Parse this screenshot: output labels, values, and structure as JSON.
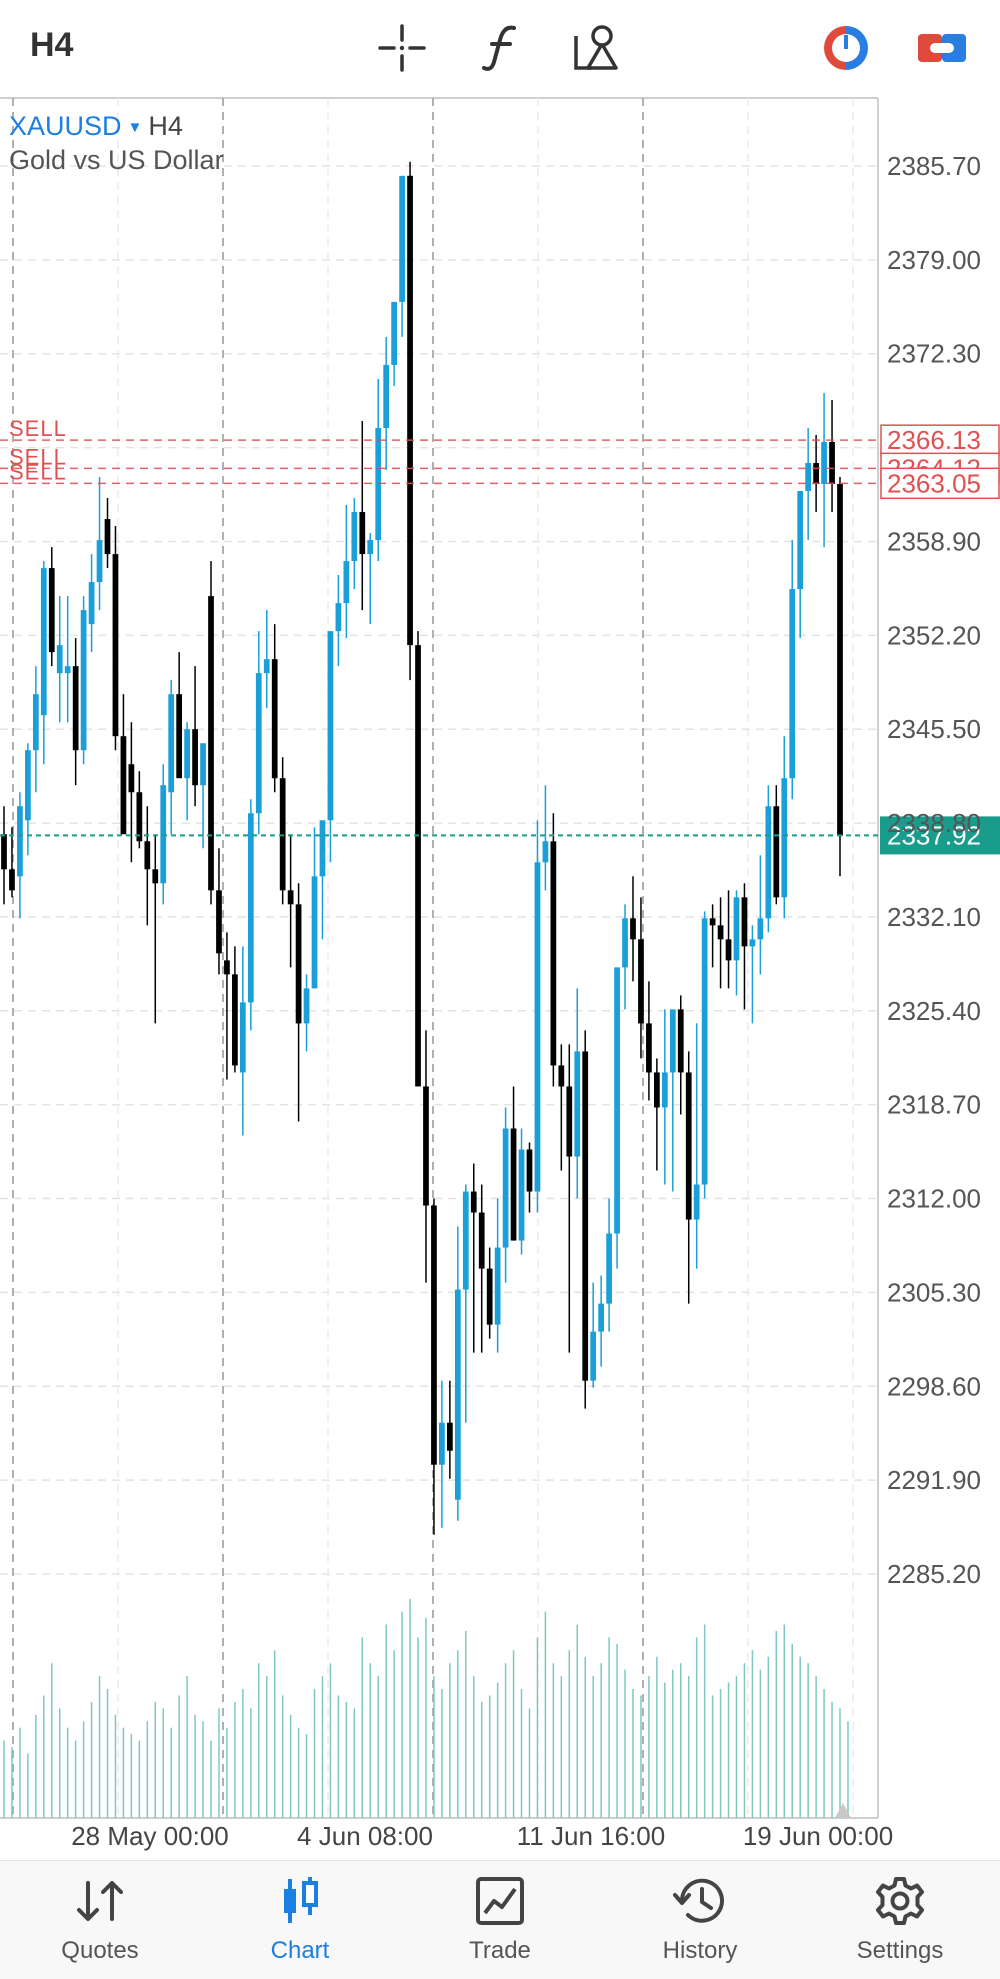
{
  "toolbar": {
    "timeframe": "H4",
    "icons": [
      "crosshair-icon",
      "indicators-icon",
      "objects-icon",
      "one-click-trading-icon",
      "toggle-icon"
    ]
  },
  "chart_header": {
    "symbol": "XAUUSD",
    "timeframe": "H4",
    "description": "Gold vs US Dollar"
  },
  "colors": {
    "bull": "#1a9fd9",
    "bear": "#000000",
    "volume": "#7fc8c2",
    "sell_line": "#e05050",
    "bid_line": "#1a9c8c",
    "grid": "#e3e3e3",
    "accent": "#1a7fe0"
  },
  "chart_data": {
    "type": "candlestick",
    "symbol": "XAUUSD",
    "timeframe": "H4",
    "y_ticks": [
      2385.7,
      2379.0,
      2372.3,
      2365.6,
      2358.9,
      2352.2,
      2345.5,
      2338.8,
      2332.1,
      2325.4,
      2318.7,
      2312.0,
      2305.3,
      2298.6,
      2291.9,
      2285.2
    ],
    "y_tick_labels": [
      "2385.70",
      "2379.00",
      "2372.30",
      "",
      "2358.90",
      "2352.20",
      "2345.50",
      "2338.80",
      "2332.10",
      "2325.40",
      "2318.70",
      "2312.00",
      "2305.30",
      "2298.60",
      "2291.90",
      "2285.20"
    ],
    "ylim": [
      2275.4,
      2386.2
    ],
    "x_labels": [
      "28 May 00:00",
      "4 Jun 08:00",
      "11 Jun 16:00",
      "19 Jun 00:00"
    ],
    "current_price": 2337.92,
    "current_price_label": "2337.92",
    "order_lines": [
      {
        "label": "SELL",
        "price": 2366.13,
        "price_label": "2366.13"
      },
      {
        "label": "SELL",
        "price": 2364.12,
        "price_label": "2364.12"
      },
      {
        "label": "SELL",
        "price": 2363.05,
        "price_label": "2363.05"
      }
    ],
    "candles": [
      [
        2338.0,
        2340.0,
        2333.0,
        2335.5
      ],
      [
        2335.5,
        2338.5,
        2333.5,
        2334.0
      ],
      [
        2335.0,
        2341.0,
        2332.0,
        2340.0
      ],
      [
        2339.0,
        2344.5,
        2336.5,
        2344.0
      ],
      [
        2344.0,
        2350.0,
        2341.0,
        2348.0
      ],
      [
        2346.5,
        2357.5,
        2343.0,
        2357.0
      ],
      [
        2357.0,
        2358.5,
        2350.0,
        2351.0
      ],
      [
        2349.5,
        2355.0,
        2346.0,
        2351.5
      ],
      [
        2349.5,
        2355.0,
        2346.0,
        2350.0
      ],
      [
        2350.0,
        2352.0,
        2341.5,
        2344.0
      ],
      [
        2344.0,
        2355.0,
        2343.0,
        2354.0
      ],
      [
        2353.0,
        2358.0,
        2351.0,
        2356.0
      ],
      [
        2356.0,
        2363.5,
        2354.0,
        2359.0
      ],
      [
        2360.5,
        2362.0,
        2357.0,
        2358.0
      ],
      [
        2358.0,
        2360.0,
        2344.0,
        2345.0
      ],
      [
        2345.0,
        2348.0,
        2339.0,
        2338.0
      ],
      [
        2343.0,
        2346.0,
        2336.0,
        2341.0
      ],
      [
        2341.0,
        2342.5,
        2337.0,
        2337.5
      ],
      [
        2337.5,
        2340.0,
        2331.5,
        2335.5
      ],
      [
        2335.5,
        2338.0,
        2324.5,
        2334.5
      ],
      [
        2334.5,
        2343.0,
        2333.0,
        2341.5
      ],
      [
        2341.0,
        2349.0,
        2338.0,
        2348.0
      ],
      [
        2348.0,
        2351.0,
        2342.5,
        2342.0
      ],
      [
        2342.0,
        2346.0,
        2339.0,
        2345.5
      ],
      [
        2345.5,
        2350.0,
        2340.0,
        2341.5
      ],
      [
        2341.5,
        2344.0,
        2337.0,
        2344.5
      ],
      [
        2355.0,
        2357.5,
        2333.0,
        2334.0
      ],
      [
        2334.0,
        2337.0,
        2328.0,
        2329.5
      ],
      [
        2329.0,
        2331.0,
        2320.5,
        2328.0
      ],
      [
        2328.0,
        2330.0,
        2321.0,
        2321.5
      ],
      [
        2321.0,
        2330.0,
        2316.5,
        2326.0
      ],
      [
        2326.0,
        2340.5,
        2324.0,
        2339.5
      ],
      [
        2339.5,
        2352.5,
        2338.0,
        2349.5
      ],
      [
        2349.5,
        2354.0,
        2347.0,
        2350.5
      ],
      [
        2350.5,
        2353.0,
        2341.0,
        2342.0
      ],
      [
        2342.0,
        2343.5,
        2333.0,
        2334.0
      ],
      [
        2334.0,
        2338.0,
        2328.5,
        2333.0
      ],
      [
        2333.0,
        2334.5,
        2317.5,
        2324.5
      ],
      [
        2324.5,
        2328.0,
        2322.5,
        2327.0
      ],
      [
        2327.0,
        2338.5,
        2327.0,
        2335.0
      ],
      [
        2335.0,
        2338.0,
        2330.5,
        2339.0
      ],
      [
        2339.0,
        2348.0,
        2336.0,
        2352.5
      ],
      [
        2352.5,
        2356.5,
        2350.0,
        2354.5
      ],
      [
        2354.5,
        2361.5,
        2352.0,
        2357.5
      ],
      [
        2357.5,
        2362.0,
        2355.5,
        2361.0
      ],
      [
        2361.0,
        2367.5,
        2354.0,
        2358.0
      ],
      [
        2358.0,
        2359.5,
        2353.0,
        2359.0
      ],
      [
        2359.0,
        2370.5,
        2357.5,
        2367.0
      ],
      [
        2367.0,
        2373.5,
        2364.0,
        2371.5
      ],
      [
        2371.5,
        2375.5,
        2370.0,
        2376.0
      ],
      [
        2376.0,
        2383.0,
        2373.5,
        2385.0
      ],
      [
        2385.0,
        2386.0,
        2349.0,
        2351.5
      ],
      [
        2351.5,
        2352.5,
        2325.0,
        2320.0
      ],
      [
        2320.0,
        2324.0,
        2306.0,
        2311.5
      ],
      [
        2311.5,
        2312.0,
        2288.0,
        2293.0
      ],
      [
        2293.0,
        2299.0,
        2288.5,
        2296.0
      ],
      [
        2296.0,
        2299.0,
        2292.0,
        2294.0
      ],
      [
        2290.5,
        2310.0,
        2289.0,
        2305.5
      ],
      [
        2305.5,
        2313.0,
        2296.0,
        2312.5
      ],
      [
        2312.5,
        2314.5,
        2301.0,
        2311.0
      ],
      [
        2311.0,
        2313.0,
        2301.0,
        2307.0
      ],
      [
        2307.0,
        2308.5,
        2302.0,
        2303.0
      ],
      [
        2303.0,
        2312.0,
        2301.0,
        2308.5
      ],
      [
        2308.5,
        2318.5,
        2306.0,
        2317.0
      ],
      [
        2317.0,
        2320.0,
        2309.0,
        2309.0
      ],
      [
        2309.0,
        2317.0,
        2308.0,
        2315.5
      ],
      [
        2315.5,
        2316.0,
        2311.0,
        2312.5
      ],
      [
        2312.5,
        2339.0,
        2311.0,
        2336.0
      ],
      [
        2336.0,
        2341.5,
        2334.0,
        2337.5
      ],
      [
        2337.5,
        2339.5,
        2320.0,
        2321.5
      ],
      [
        2321.5,
        2323.0,
        2314.0,
        2320.0
      ],
      [
        2320.0,
        2323.0,
        2301.0,
        2315.0
      ],
      [
        2315.0,
        2327.0,
        2312.0,
        2322.5
      ],
      [
        2322.5,
        2324.0,
        2297.0,
        2299.0
      ],
      [
        2299.0,
        2306.0,
        2298.5,
        2302.5
      ],
      [
        2302.5,
        2306.5,
        2300.0,
        2304.5
      ],
      [
        2304.5,
        2312.0,
        2302.5,
        2309.5
      ],
      [
        2309.5,
        2321.5,
        2307.0,
        2328.5
      ],
      [
        2328.5,
        2333.0,
        2325.5,
        2332.0
      ],
      [
        2332.0,
        2335.0,
        2327.5,
        2330.5
      ],
      [
        2330.5,
        2333.5,
        2322.0,
        2324.5
      ],
      [
        2324.5,
        2327.5,
        2319.0,
        2321.0
      ],
      [
        2321.0,
        2322.0,
        2314.0,
        2318.5
      ],
      [
        2318.5,
        2325.5,
        2313.0,
        2321.0
      ],
      [
        2321.0,
        2325.0,
        2312.5,
        2325.5
      ],
      [
        2325.5,
        2326.5,
        2318.0,
        2321.0
      ],
      [
        2321.0,
        2322.5,
        2304.5,
        2310.5
      ],
      [
        2310.5,
        2324.5,
        2307.0,
        2313.0
      ],
      [
        2313.0,
        2332.5,
        2312.0,
        2332.0
      ],
      [
        2332.0,
        2333.0,
        2328.5,
        2331.5
      ],
      [
        2331.5,
        2333.5,
        2327.0,
        2330.5
      ],
      [
        2330.5,
        2334.0,
        2327.0,
        2329.0
      ],
      [
        2329.0,
        2334.0,
        2326.5,
        2333.5
      ],
      [
        2333.5,
        2334.5,
        2325.5,
        2330.0
      ],
      [
        2330.0,
        2331.5,
        2324.5,
        2330.5
      ],
      [
        2330.5,
        2336.5,
        2328.0,
        2332.0
      ],
      [
        2332.0,
        2341.5,
        2331.0,
        2340.0
      ],
      [
        2340.0,
        2341.5,
        2333.0,
        2333.5
      ],
      [
        2333.5,
        2345.0,
        2332.0,
        2342.0
      ],
      [
        2342.0,
        2359.0,
        2340.5,
        2355.5
      ],
      [
        2355.5,
        2361.5,
        2352.0,
        2362.5
      ],
      [
        2362.5,
        2367.0,
        2359.0,
        2364.5
      ],
      [
        2364.5,
        2366.5,
        2361.0,
        2363.0
      ],
      [
        2363.0,
        2369.5,
        2358.5,
        2366.0
      ],
      [
        2366.0,
        2369.0,
        2361.0,
        2363.0
      ],
      [
        2363.0,
        2363.5,
        2335.0,
        2337.9
      ]
    ],
    "volume_max": 200,
    "volumes": [
      60,
      55,
      70,
      50,
      80,
      95,
      120,
      85,
      70,
      60,
      75,
      90,
      110,
      100,
      80,
      70,
      65,
      60,
      75,
      90,
      85,
      70,
      95,
      110,
      80,
      75,
      60,
      85,
      70,
      90,
      100,
      85,
      120,
      110,
      130,
      95,
      80,
      70,
      65,
      100,
      110,
      120,
      95,
      90,
      85,
      140,
      120,
      110,
      150,
      130,
      160,
      170,
      140,
      155,
      110,
      100,
      120,
      130,
      145,
      110,
      90,
      95,
      105,
      120,
      130,
      100,
      85,
      140,
      160,
      120,
      110,
      130,
      150,
      125,
      110,
      120,
      140,
      135,
      115,
      100,
      95,
      110,
      125,
      105,
      115,
      120,
      110,
      140,
      150,
      95,
      100,
      105,
      110,
      120,
      130,
      115,
      125,
      145,
      150,
      135,
      125,
      120,
      110,
      100,
      90,
      85,
      75
    ]
  },
  "nav": [
    {
      "label": "Quotes",
      "icon": "quotes-icon",
      "active": false
    },
    {
      "label": "Chart",
      "icon": "chart-icon",
      "active": true
    },
    {
      "label": "Trade",
      "icon": "trade-icon",
      "active": false
    },
    {
      "label": "History",
      "icon": "history-icon",
      "active": false
    },
    {
      "label": "Settings",
      "icon": "settings-icon",
      "active": false
    }
  ]
}
